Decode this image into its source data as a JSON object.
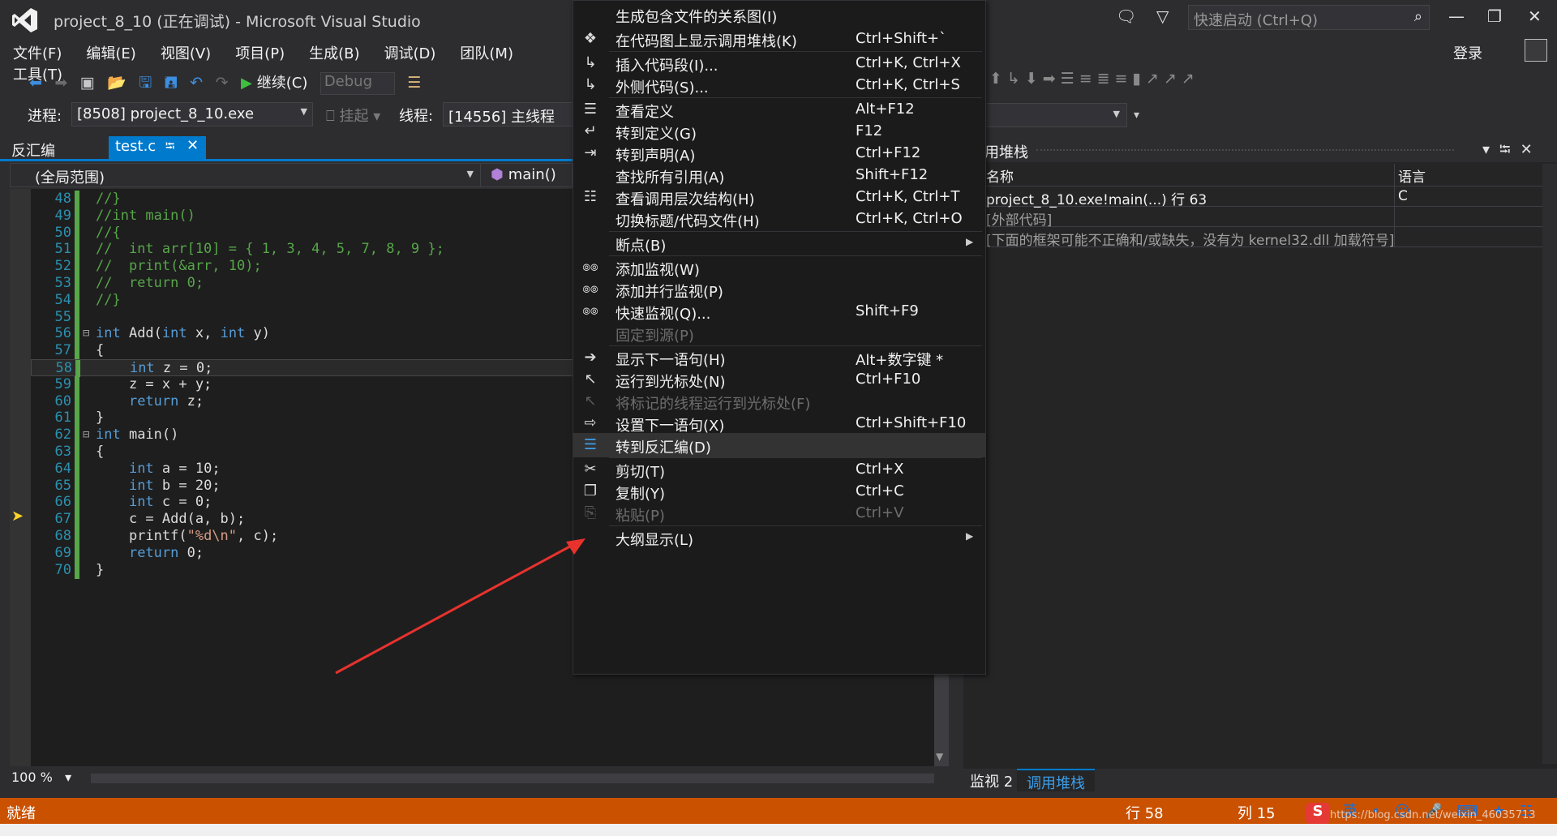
{
  "window": {
    "title": "project_8_10 (正在调试) - Microsoft Visual Studio",
    "quick_launch_placeholder": "快速启动 (Ctrl+Q)",
    "login": "登录"
  },
  "menubar": [
    "文件(F)",
    "编辑(E)",
    "视图(V)",
    "项目(P)",
    "生成(B)",
    "调试(D)",
    "团队(M)",
    "工具(T)"
  ],
  "toolbar": {
    "continue_label": "继续(C)",
    "config": "Debug"
  },
  "debugbar": {
    "process_label": "进程:",
    "process_value": "[8508] project_8_10.exe",
    "suspend_label": "挂起",
    "thread_label": "线程:",
    "thread_value": "[14556] 主线程"
  },
  "tabs": {
    "disasm": "反汇编",
    "active": "test.c"
  },
  "navbar": {
    "scope": "(全局范围)",
    "function": "main()"
  },
  "editor": {
    "zoom": "100 %",
    "lines": [
      {
        "n": "48",
        "text": "//}"
      },
      {
        "n": "49",
        "text": "//int main()"
      },
      {
        "n": "50",
        "text": "//{"
      },
      {
        "n": "51",
        "text": "//  int arr[10] = { 1, 3, 4, 5, 7, 8, 9 };"
      },
      {
        "n": "52",
        "text": "//  print(&arr, 10);"
      },
      {
        "n": "53",
        "text": "//  return 0;"
      },
      {
        "n": "54",
        "text": "//}"
      },
      {
        "n": "55",
        "text": ""
      },
      {
        "n": "56",
        "text": "int Add(int x, int y)"
      },
      {
        "n": "57",
        "text": "{"
      },
      {
        "n": "58",
        "text": "    int z = 0;"
      },
      {
        "n": "59",
        "text": "    z = x + y;"
      },
      {
        "n": "60",
        "text": "    return z;"
      },
      {
        "n": "61",
        "text": "}"
      },
      {
        "n": "62",
        "text": "int main()"
      },
      {
        "n": "63",
        "text": "{"
      },
      {
        "n": "64",
        "text": "    int a = 10;"
      },
      {
        "n": "65",
        "text": "    int b = 20;"
      },
      {
        "n": "66",
        "text": "    int c = 0;"
      },
      {
        "n": "67",
        "text": "    c = Add(a, b);"
      },
      {
        "n": "68",
        "text": "    printf(\"%d\\n\", c);"
      },
      {
        "n": "69",
        "text": "    return 0;"
      },
      {
        "n": "70",
        "text": "}"
      }
    ]
  },
  "context_menu": [
    {
      "label": "生成包含文件的关系图(I)",
      "shortcut": "",
      "icon": "none"
    },
    {
      "label": "在代码图上显示调用堆栈(K)",
      "shortcut": "Ctrl+Shift+`",
      "icon": "code-map-icon"
    },
    {
      "label": "插入代码段(I)...",
      "shortcut": "Ctrl+K, Ctrl+X",
      "icon": "snippet-icon"
    },
    {
      "label": "外侧代码(S)...",
      "shortcut": "Ctrl+K, Ctrl+S",
      "icon": "surround-icon"
    },
    {
      "label": "查看定义",
      "shortcut": "Alt+F12",
      "icon": "peek-definition-icon"
    },
    {
      "label": "转到定义(G)",
      "shortcut": "F12",
      "icon": "goto-definition-icon"
    },
    {
      "label": "转到声明(A)",
      "shortcut": "Ctrl+F12",
      "icon": "goto-declaration-icon"
    },
    {
      "label": "查找所有引用(A)",
      "shortcut": "Shift+F12",
      "icon": "none"
    },
    {
      "label": "查看调用层次结构(H)",
      "shortcut": "Ctrl+K, Ctrl+T",
      "icon": "call-hierarchy-icon"
    },
    {
      "label": "切换标题/代码文件(H)",
      "shortcut": "Ctrl+K, Ctrl+O",
      "icon": "none"
    },
    {
      "label": "断点(B)",
      "shortcut": "",
      "icon": "none",
      "submenu": true
    },
    {
      "label": "添加监视(W)",
      "shortcut": "",
      "icon": "glasses-icon"
    },
    {
      "label": "添加并行监视(P)",
      "shortcut": "",
      "icon": "glasses-icon"
    },
    {
      "label": "快速监视(Q)...",
      "shortcut": "Shift+F9",
      "icon": "glasses-icon"
    },
    {
      "label": "固定到源(P)",
      "shortcut": "",
      "icon": "none",
      "disabled": true
    },
    {
      "label": "显示下一语句(H)",
      "shortcut": "Alt+数字键 *",
      "icon": "arrow-right-icon"
    },
    {
      "label": "运行到光标处(N)",
      "shortcut": "Ctrl+F10",
      "icon": "cursor-icon"
    },
    {
      "label": "将标记的线程运行到光标处(F)",
      "shortcut": "",
      "icon": "cursor-icon",
      "disabled": true
    },
    {
      "label": "设置下一语句(X)",
      "shortcut": "Ctrl+Shift+F10",
      "icon": "set-next-icon"
    },
    {
      "label": "转到反汇编(D)",
      "shortcut": "",
      "icon": "disassembly-icon",
      "highlighted": true
    },
    {
      "label": "剪切(T)",
      "shortcut": "Ctrl+X",
      "icon": "scissors-icon"
    },
    {
      "label": "复制(Y)",
      "shortcut": "Ctrl+C",
      "icon": "copy-icon"
    },
    {
      "label": "粘贴(P)",
      "shortcut": "Ctrl+V",
      "icon": "paste-icon",
      "disabled": true
    },
    {
      "label": "大纲显示(L)",
      "shortcut": "",
      "icon": "none",
      "submenu": true
    }
  ],
  "callstack": {
    "title": "用堆栈",
    "col_name": "名称",
    "col_lang": "语言",
    "rows": [
      {
        "name": "project_8_10.exe!main(...) 行 63",
        "lang": "C"
      },
      {
        "name": "[外部代码]",
        "lang": ""
      },
      {
        "name": "[下面的框架可能不正确和/或缺失，没有为 kernel32.dll 加载符号]",
        "lang": ""
      }
    ]
  },
  "bottom_tabs": {
    "watch": "监视 2",
    "callstack": "调用堆栈"
  },
  "statusbar": {
    "ready": "就绪",
    "line": "行 58",
    "col": "列 15",
    "ime_lang": "英",
    "watermark": "https://blog.csdn.net/weixin_46035713"
  },
  "colors": {
    "accent": "#007acc",
    "status": "#ca5100",
    "annotation": "#e8322d"
  }
}
